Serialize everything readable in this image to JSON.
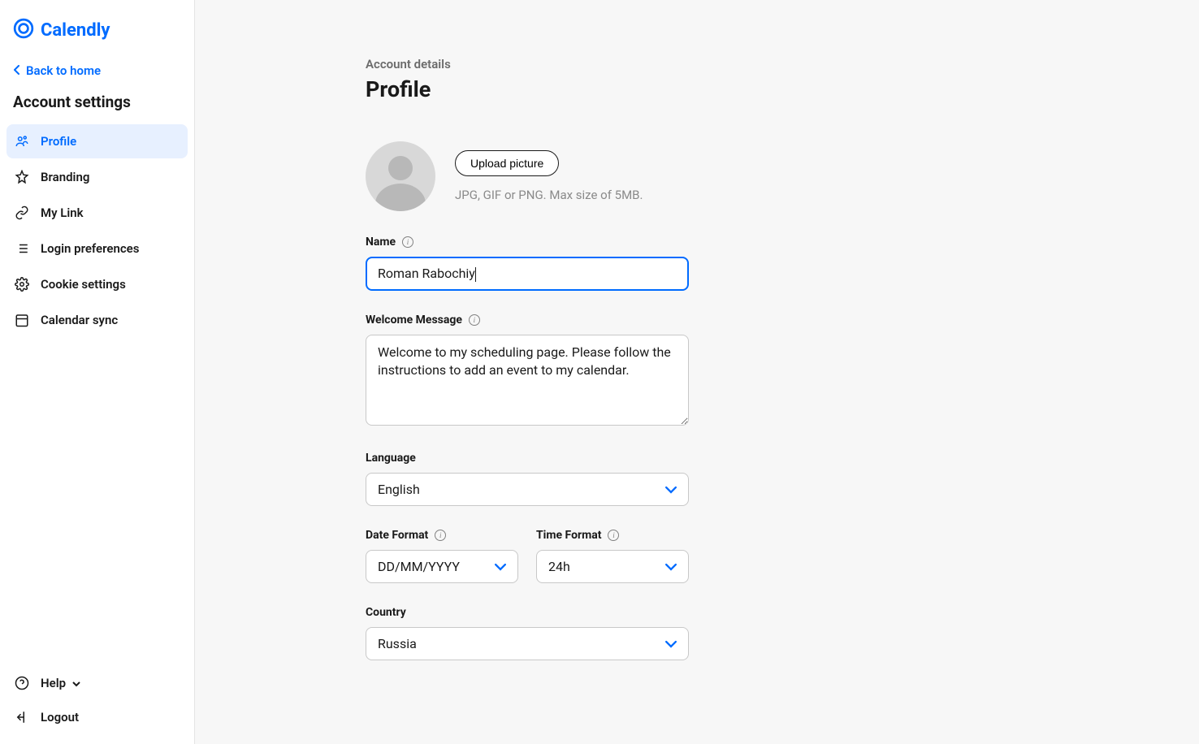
{
  "brand": "Calendly",
  "sidebar": {
    "back": "Back to home",
    "title": "Account settings",
    "items": [
      {
        "label": "Profile"
      },
      {
        "label": "Branding"
      },
      {
        "label": "My Link"
      },
      {
        "label": "Login preferences"
      },
      {
        "label": "Cookie settings"
      },
      {
        "label": "Calendar sync"
      }
    ],
    "help": "Help",
    "logout": "Logout"
  },
  "main": {
    "crumb": "Account details",
    "title": "Profile",
    "upload_label": "Upload picture",
    "upload_hint": "JPG, GIF or PNG. Max size of 5MB.",
    "fields": {
      "name_label": "Name",
      "name_value": "Roman Rabochiy",
      "welcome_label": "Welcome Message",
      "welcome_value": "Welcome to my scheduling page. Please follow the instructions to add an event to my calendar.",
      "language_label": "Language",
      "language_value": "English",
      "date_format_label": "Date Format",
      "date_format_value": "DD/MM/YYYY",
      "time_format_label": "Time Format",
      "time_format_value": "24h",
      "country_label": "Country",
      "country_value": "Russia"
    }
  }
}
